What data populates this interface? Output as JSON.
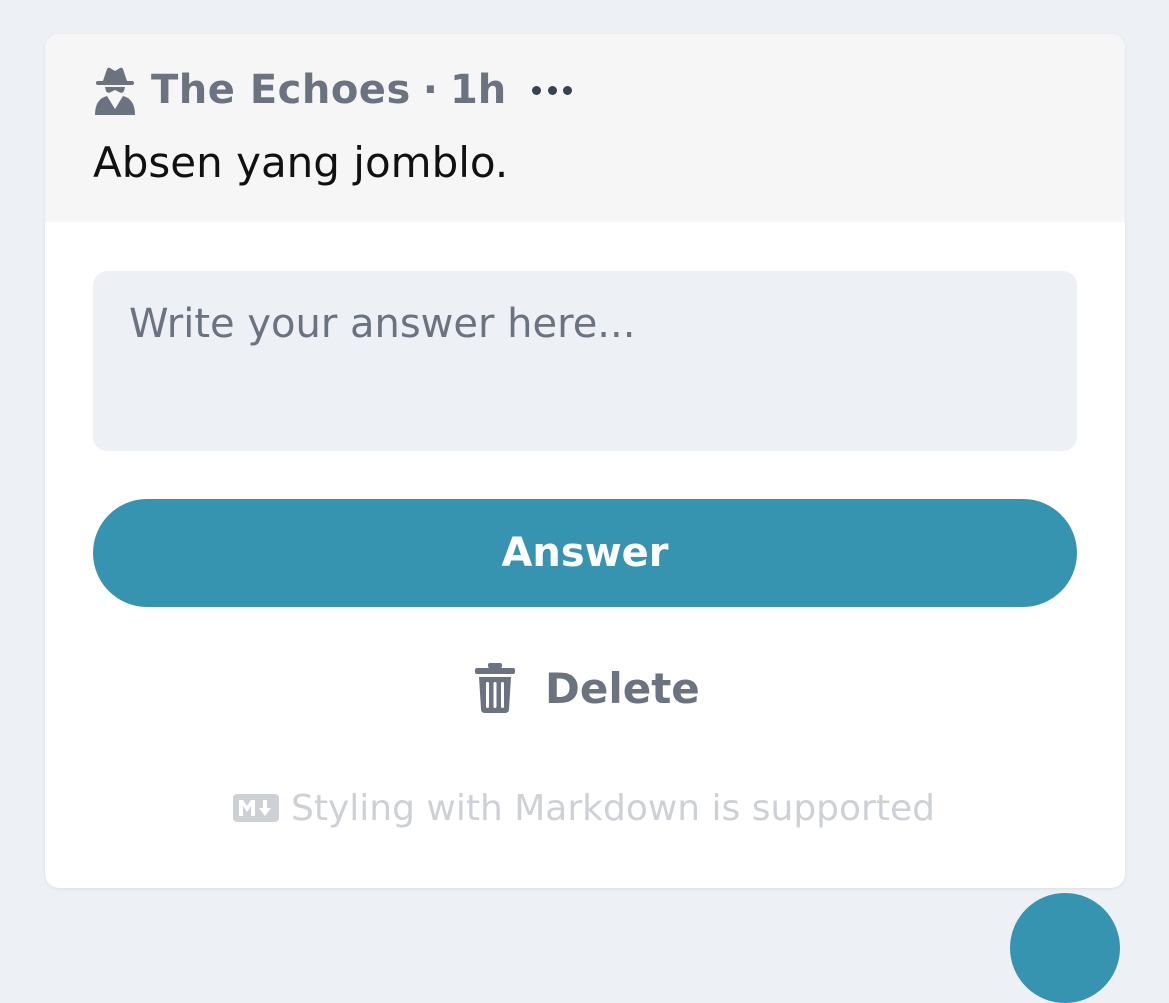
{
  "post": {
    "author": "The Echoes",
    "separator": "·",
    "time": "1h",
    "question": "Absen yang jomblo."
  },
  "answer_form": {
    "placeholder": "Write your answer here...",
    "value": "",
    "submit_label": "Answer",
    "delete_label": "Delete",
    "markdown_note": "Styling with Markdown is supported"
  },
  "icons": {
    "author": "spy-icon",
    "menu": "more-horizontal-icon",
    "delete": "trash-icon",
    "markdown": "markdown-icon"
  },
  "colors": {
    "accent": "#3794b1",
    "muted_text": "#6b7280",
    "header_bg": "#f6f6f6",
    "input_bg": "#edf1f5",
    "page_bg": "#edf1f5"
  }
}
